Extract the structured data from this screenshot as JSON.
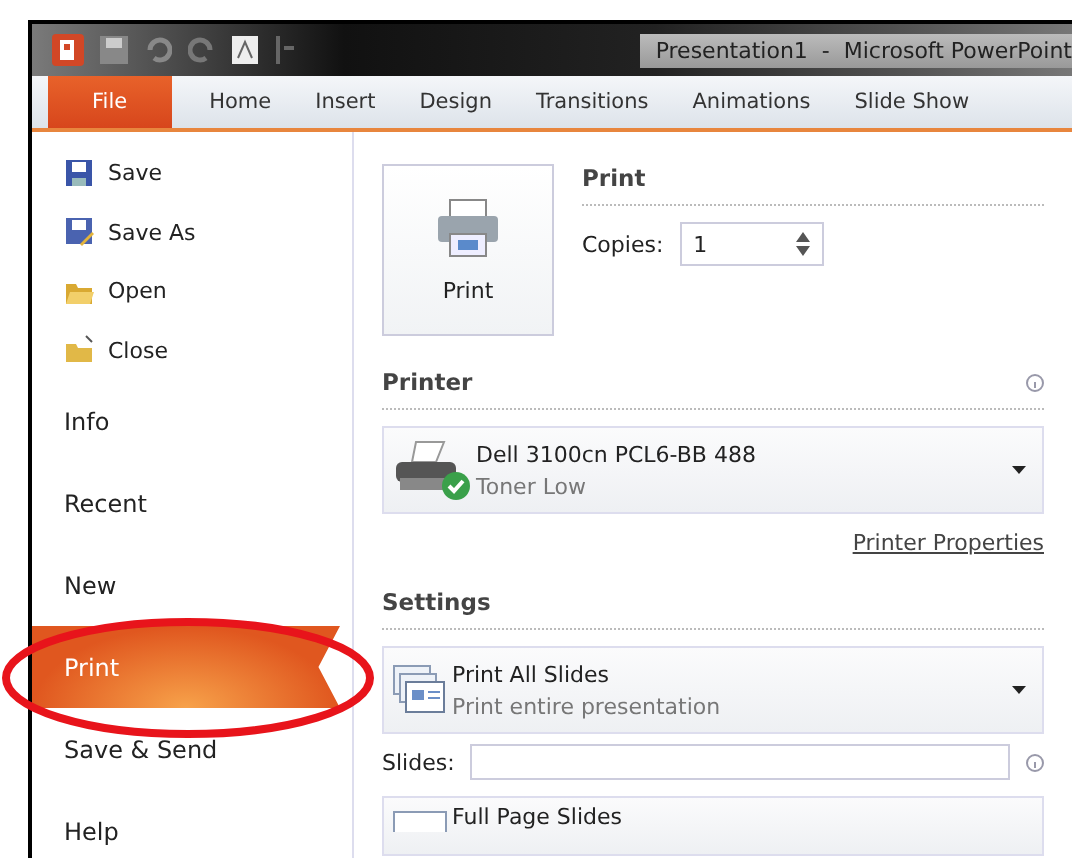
{
  "window": {
    "title": "Presentation1  -  Microsoft PowerPoint"
  },
  "tabs": [
    {
      "label": "File",
      "selected": true
    },
    {
      "label": "Home",
      "selected": false
    },
    {
      "label": "Insert",
      "selected": false
    },
    {
      "label": "Design",
      "selected": false
    },
    {
      "label": "Transitions",
      "selected": false
    },
    {
      "label": "Animations",
      "selected": false
    },
    {
      "label": "Slide Show",
      "selected": false
    }
  ],
  "sidebar": {
    "commands": [
      {
        "label": "Save",
        "kind": "save"
      },
      {
        "label": "Save As",
        "kind": "saveas"
      },
      {
        "label": "Open",
        "kind": "open"
      },
      {
        "label": "Close",
        "kind": "close"
      }
    ],
    "items": [
      {
        "label": "Info",
        "selected": false
      },
      {
        "label": "Recent",
        "selected": false
      },
      {
        "label": "New",
        "selected": false
      },
      {
        "label": "Print",
        "selected": true
      },
      {
        "label": "Save & Send",
        "selected": false
      },
      {
        "label": "Help",
        "selected": false
      }
    ]
  },
  "print": {
    "heading": "Print",
    "button": "Print",
    "copies_label": "Copies:",
    "copies": "1"
  },
  "printer": {
    "heading": "Printer",
    "name": "Dell 3100cn PCL6-BB 488",
    "status": "Toner Low",
    "properties_link": "Printer Properties"
  },
  "settings": {
    "heading": "Settings",
    "slides_label": "Slides:",
    "options": [
      {
        "title": "Print All Slides",
        "subtitle": "Print entire presentation",
        "kind": "slides"
      },
      {
        "title": "Full Page Slides",
        "kind": "page"
      }
    ]
  }
}
